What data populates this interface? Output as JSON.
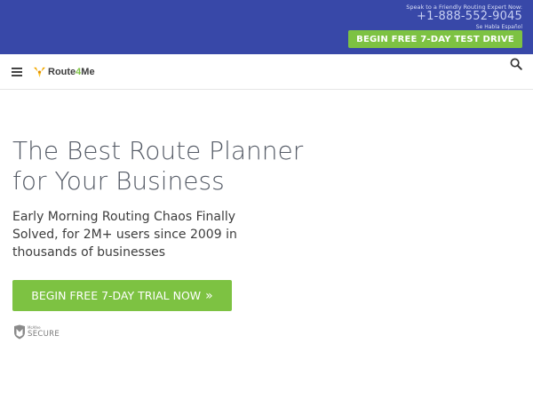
{
  "topbar": {
    "speak_text": "Speak to a Friendly Routing Expert Now:",
    "phone": "+1-888-552-9045",
    "spanish_text": "Se Habla Español",
    "cta_label": "BEGIN FREE 7-DAY TEST DRIVE",
    "background_color": "#3848a8",
    "accent_color": "#7dc242"
  },
  "navbar": {
    "menu_icon": "hamburger-icon",
    "logo_text_part1": "Route",
    "logo_text_part2": "4",
    "logo_text_part3": "Me",
    "search_icon": "search-icon"
  },
  "hero": {
    "title_line1": "The Best Route Planner",
    "title_line2": "for Your Business",
    "subtitle": "Early Morning Routing Chaos Finally Solved, for 2M+ users since 2009 in thousands of businesses",
    "cta_label": "BEGIN FREE 7-DAY TRIAL NOW",
    "cta_icon": "double-chevron-right-icon",
    "cta_glyph": "»"
  },
  "badge": {
    "brand": "McAfee",
    "label": "SECURE"
  }
}
